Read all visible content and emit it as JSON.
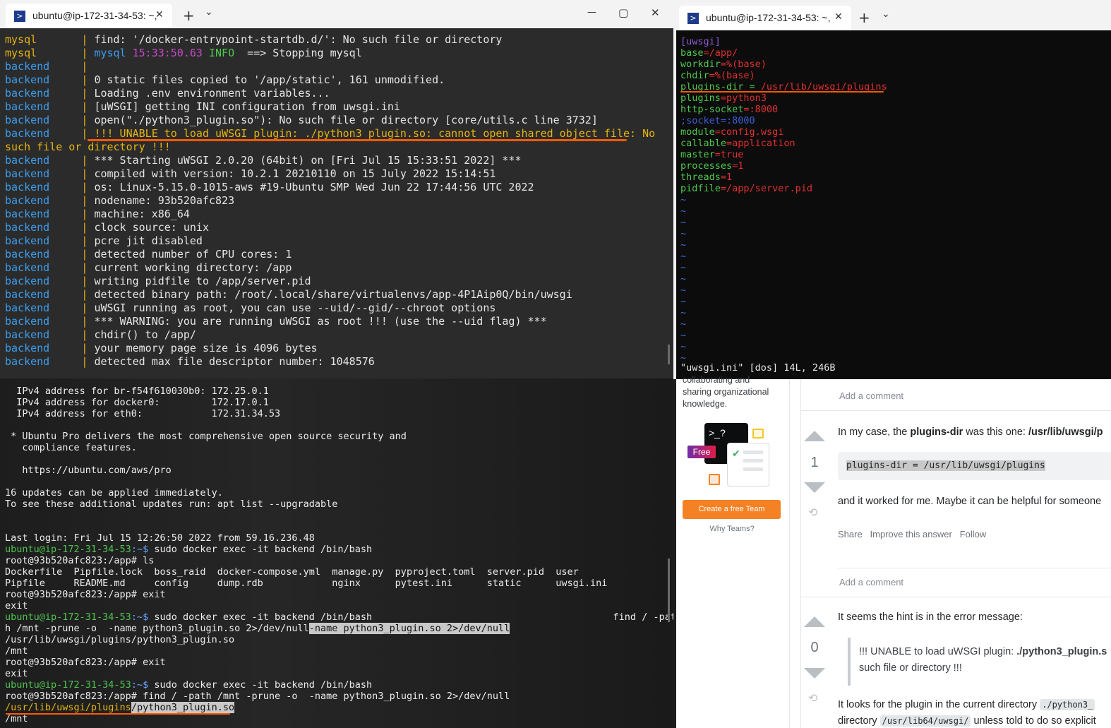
{
  "left_window": {
    "tab_title": "ubuntu@ip-172-31-34-53: ~,",
    "new_tab": "+",
    "dropdown": "⌄",
    "minimize": "—",
    "maximize": "▢",
    "close": "✕"
  },
  "top_log": [
    {
      "svc": "mysql",
      "msg": "find: '/docker-entrypoint-startdb.d/': No such file or directory"
    },
    {
      "svc": "mysql",
      "msg_a": "mysql ",
      "msg_b": "15:33:50.63 ",
      "msg_c": "INFO ",
      "msg_d": " ==> Stopping mysql"
    },
    {
      "svc": "backend",
      "msg": ""
    },
    {
      "svc": "backend",
      "msg": "0 static files copied to '/app/static', 161 unmodified."
    },
    {
      "svc": "backend",
      "msg": "Loading .env environment variables..."
    },
    {
      "svc": "backend",
      "msg": "[uWSGI] getting INI configuration from uwsgi.ini"
    },
    {
      "svc": "backend",
      "msg": "open(\"./python3_plugin.so\"): No such file or directory [core/utils.c line 3732]"
    },
    {
      "svc": "backend",
      "msg": "!!! UNABLE to load uWSGI plugin: ./python3_plugin.so: cannot open shared object file: No"
    },
    {
      "svc": "",
      "msg": "such file or directory !!!"
    },
    {
      "svc": "backend",
      "msg": "*** Starting uWSGI 2.0.20 (64bit) on [Fri Jul 15 15:33:51 2022] ***"
    },
    {
      "svc": "backend",
      "msg": "compiled with version: 10.2.1 20210110 on 15 July 2022 15:14:51"
    },
    {
      "svc": "backend",
      "msg": "os: Linux-5.15.0-1015-aws #19-Ubuntu SMP Wed Jun 22 17:44:56 UTC 2022"
    },
    {
      "svc": "backend",
      "msg": "nodename: 93b520afc823"
    },
    {
      "svc": "backend",
      "msg": "machine: x86_64"
    },
    {
      "svc": "backend",
      "msg": "clock source: unix"
    },
    {
      "svc": "backend",
      "msg": "pcre jit disabled"
    },
    {
      "svc": "backend",
      "msg": "detected number of CPU cores: 1"
    },
    {
      "svc": "backend",
      "msg": "current working directory: /app"
    },
    {
      "svc": "backend",
      "msg": "writing pidfile to /app/server.pid"
    },
    {
      "svc": "backend",
      "msg": "detected binary path: /root/.local/share/virtualenvs/app-4P1Aip0Q/bin/uwsgi"
    },
    {
      "svc": "backend",
      "msg": "uWSGI running as root, you can use --uid/--gid/--chroot options"
    },
    {
      "svc": "backend",
      "msg": "*** WARNING: you are running uWSGI as root !!! (use the --uid flag) ***"
    },
    {
      "svc": "backend",
      "msg": "chdir() to /app/"
    },
    {
      "svc": "backend",
      "msg": "your memory page size is 4096 bytes"
    },
    {
      "svc": "backend",
      "msg": "detected max file descriptor number: 1048576"
    }
  ],
  "bottom_term": {
    "l1": "  IPv4 address for br-f54f610030b0: 172.25.0.1",
    "l2": "  IPv4 address for docker0:         172.17.0.1",
    "l3": "  IPv4 address for eth0:            172.31.34.53",
    "l4": " * Ubuntu Pro delivers the most comprehensive open source security and",
    "l5": "   compliance features.",
    "l6": "   https://ubuntu.com/aws/pro",
    "l7": "16 updates can be applied immediately.",
    "l8": "To see these additional updates run: apt list --upgradable",
    "l9": "Last login: Fri Jul 15 12:26:50 2022 from 59.16.236.48",
    "prompt_user": "ubuntu@ip-172-31-34-53",
    "prompt_path": ":~$",
    "cmd_exec": " sudo docker exec -it backend /bin/bash",
    "root_prompt": "root@93b520afc823:/app# ",
    "ls": "ls",
    "ls1": "Dockerfile  Pipfile.lock  boss_raid  docker-compose.yml  manage.py  pyproject.toml  server.pid  user",
    "ls2": "Pipfile     README.md     config     dump.rdb            nginx      pytest.ini      static      uwsgi.ini",
    "exit": "exit",
    "find_tail": "                                          find / -pat",
    "find_wrap_a": "h /mnt -prune -o  -name python3_plugin.so 2>/dev/null",
    "find_wrap_b": "-name python3_plugin.so 2>/dev/null",
    "found_path": "/usr/lib/uwsgi/plugins/python3_plugin.so",
    "mnt": "/mnt",
    "find_cmd": "find / -path /mnt -prune -o  -name python3_plugin.so 2>/dev/null",
    "found2_a": "/usr/lib/uwsgi/plugins",
    "found2_b": "/python3_plugin.so"
  },
  "right_window": {
    "tab_title": "ubuntu@ip-172-31-34-53: ~,",
    "new_tab": "+",
    "dropdown": "⌄"
  },
  "vim": {
    "header": "[uwsgi]",
    "rows": [
      {
        "k": "base",
        "v": "/app/"
      },
      {
        "k": "workdir",
        "v": "%(base)"
      },
      {
        "k": "chdir",
        "v": "%(base)"
      },
      {
        "k": "plugins-dir = ",
        "v": "/usr/lib/uwsgi/plugins"
      },
      {
        "k": "plugins",
        "v": "python3"
      },
      {
        "k": "http-socket",
        "v": ":8000"
      },
      {
        "k": ";socket=:8000",
        "v": ""
      },
      {
        "k": "module",
        "v": "config.wsgi"
      },
      {
        "k": "callable",
        "v": "application"
      },
      {
        "k": "master",
        "v": "true"
      },
      {
        "k": "processes",
        "v": "1"
      },
      {
        "k": "threads",
        "v": "1"
      },
      {
        "k": "pidfile",
        "v": "/app/server.pid"
      }
    ],
    "eq": "=",
    "tilde": "~",
    "status": "\"uwsgi.ini\" [dos] 14L, 246B"
  },
  "web": {
    "side_text1": "collaborating and",
    "side_text2": "sharing organizational",
    "side_text3": "knowledge.",
    "promo_prompt": ">_?",
    "free_badge": "Free",
    "create_team": "Create a free Team",
    "why_teams": "Why Teams?",
    "add_comment": "Add a comment",
    "answer1": {
      "score": "1",
      "text_a": "In my case, the ",
      "text_b": "plugins-dir",
      "text_c": " was this one: ",
      "text_d": "/usr/lib/uwsgi/p",
      "code": "plugins-dir = /usr/lib/uwsgi/plugins",
      "after": "and it worked for me. Maybe it can be helpful for someone",
      "share": "Share",
      "improve": "Improve this answer",
      "follow": "Follow"
    },
    "answer2": {
      "score": "0",
      "text": "It seems the hint is in the error message:",
      "quote_a": "!!! UNABLE to load uWSGI plugin: ",
      "quote_b": "./python3_plugin.s",
      "quote_c": "such file or directory !!!",
      "p2_a": "It looks for the plugin in the current directory ",
      "p2_code": "./python3_",
      "p3_a": "directory ",
      "p3_code": "/usr/lib64/uwsgi/",
      "p3_b": " unless told to do so explicit"
    }
  }
}
